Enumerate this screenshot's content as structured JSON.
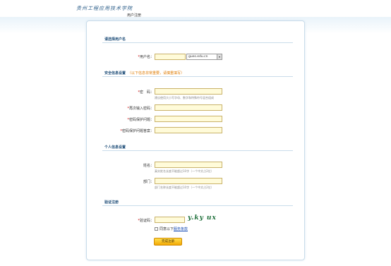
{
  "header": {
    "logo_text": "贵州工程应用技术学院",
    "page_title": "用户注册"
  },
  "sections": {
    "username": {
      "title": "请选择用户名"
    },
    "security": {
      "title": "安全信息设置",
      "note": "（以下信息非常重要，请慎重填写）"
    },
    "personal": {
      "title": "个人信息设置"
    },
    "verify": {
      "title": "验证注册"
    }
  },
  "fields": {
    "username_label": "用户名：",
    "domain_option": "gues.edu.cn",
    "password_label": "密　码：",
    "password_help": "建议使用大小写字母、数字和特殊符号混合组成",
    "password_confirm_label": "再次输入密码：",
    "question_label": "密码保护问题：",
    "answer_label": "密码保护问题答案：",
    "name_label": "姓名：",
    "name_help": "真实姓名长度不能超过10字（一个中文占2位）",
    "dept_label": "部门：",
    "dept_help": "部门名称长度不能超过10字（一个中文占2位）",
    "captcha_label": "验证码：",
    "captcha_text": "y.ky ux",
    "agree_prefix": "同意以下",
    "agree_link": "服务条款"
  },
  "buttons": {
    "submit": "完成注册"
  },
  "colors": {
    "section_title": "#1f4e79",
    "input_bg": "#fffbd9",
    "required": "#cc0000",
    "note": "#e07b00",
    "button": "#f3a905"
  }
}
